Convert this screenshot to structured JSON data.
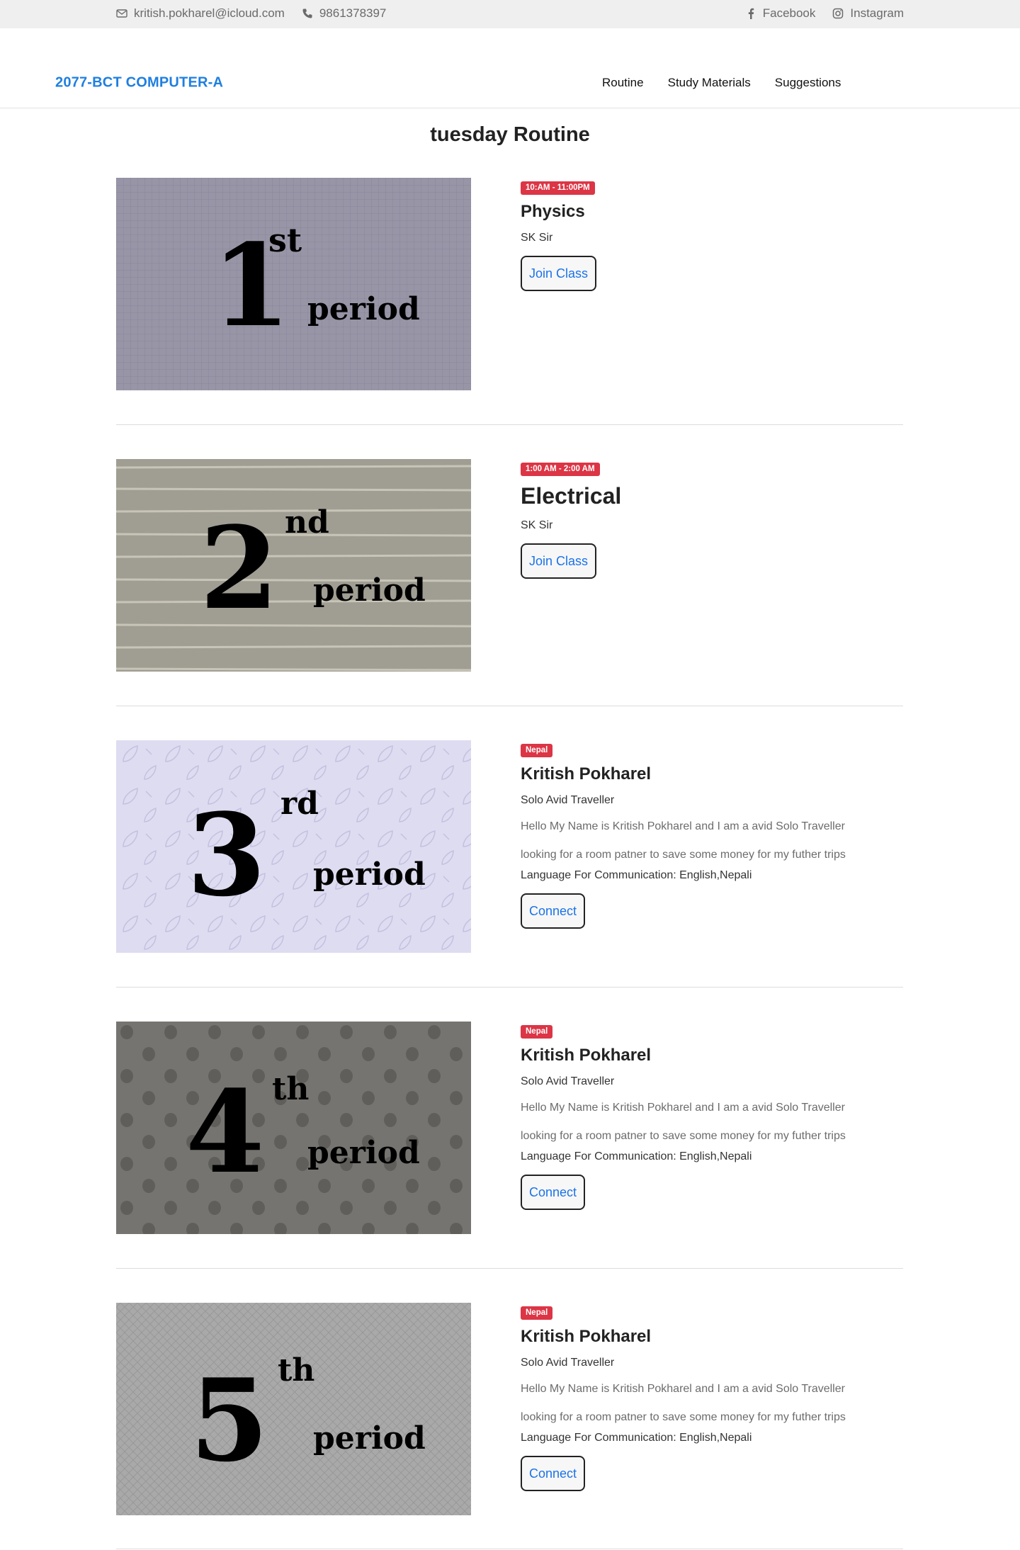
{
  "topbar": {
    "email": "kritish.pokharel@icloud.com",
    "phone": "9861378397",
    "facebook": "Facebook",
    "instagram": "Instagram"
  },
  "navbar": {
    "brand": "2077-BCT COMPUTER-A",
    "links": [
      "Routine",
      "Study Materials",
      "Suggestions"
    ]
  },
  "page": {
    "title": "tuesday Routine"
  },
  "items": [
    {
      "image": {
        "number": "1",
        "suffix": "st",
        "word": "period",
        "pattern": "grid",
        "bg": "#9896a6"
      },
      "badge": "10:AM - 11:00PM",
      "title": "Physics",
      "teacher": "SK Sir",
      "button": "Join Class"
    },
    {
      "image": {
        "number": "2",
        "suffix": "nd",
        "word": "period",
        "pattern": "stripes",
        "bg": "#a09d93"
      },
      "badge": "1:00 AM - 2:00 AM",
      "title": "Electrical",
      "teacher": "SK Sir",
      "button": "Join Class"
    },
    {
      "image": {
        "number": "3",
        "suffix": "rd",
        "word": "period",
        "pattern": "leaves",
        "bg": "#dedcf0"
      },
      "badge": "Nepal",
      "title": "Kritish Pokharel",
      "subtitle": "Solo Avid Traveller",
      "desc1": "Hello My Name is Kritish Pokharel and I am a avid Solo Traveller",
      "desc2": "looking for a room patner to save some money for my futher trips",
      "lang": "Language For Communication: English,Nepali",
      "button": "Connect"
    },
    {
      "image": {
        "number": "4",
        "suffix": "th",
        "word": "period",
        "pattern": "dots",
        "bg": "#757470"
      },
      "badge": "Nepal",
      "title": "Kritish Pokharel",
      "subtitle": "Solo Avid Traveller",
      "desc1": "Hello My Name is Kritish Pokharel and I am a avid Solo Traveller",
      "desc2": "looking for a room patner to save some money for my futher trips",
      "lang": "Language For Communication: English,Nepali",
      "button": "Connect"
    },
    {
      "image": {
        "number": "5",
        "suffix": "th",
        "word": "period",
        "pattern": "diamond",
        "bg": "#a9a9a9"
      },
      "badge": "Nepal",
      "title": "Kritish Pokharel",
      "subtitle": "Solo Avid Traveller",
      "desc1": "Hello My Name is Kritish Pokharel and I am a avid Solo Traveller",
      "desc2": "looking for a room patner to save some money for my futher trips",
      "lang": "Language For Communication: English,Nepali",
      "button": "Connect"
    }
  ]
}
